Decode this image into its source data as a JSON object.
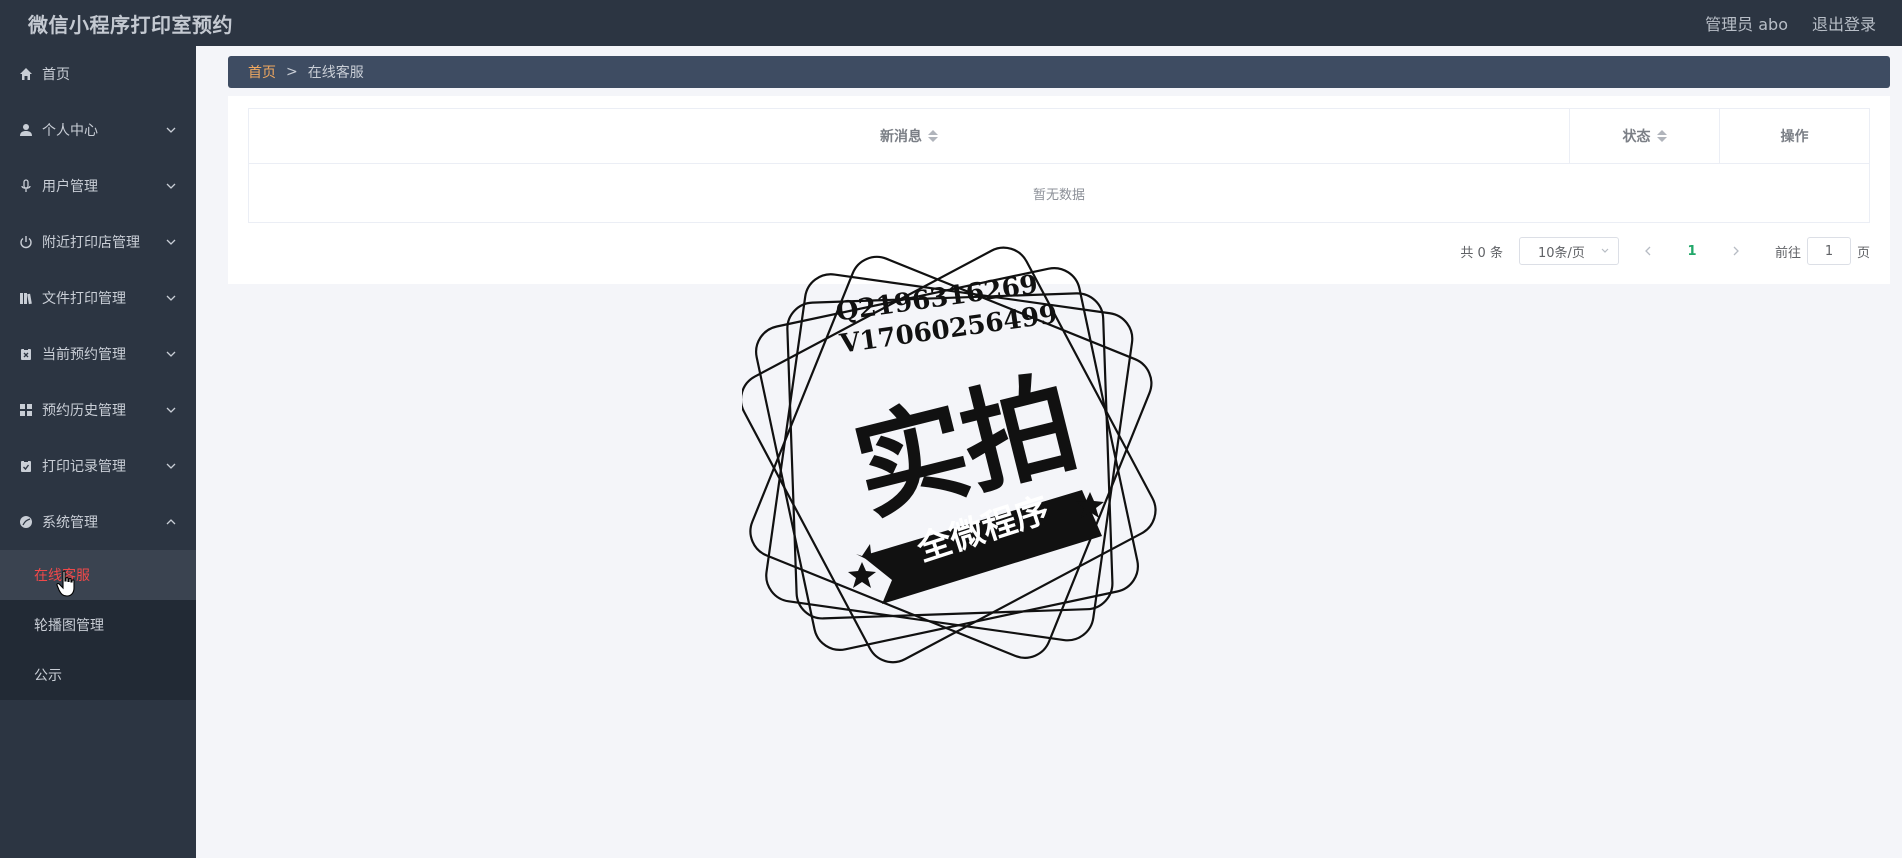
{
  "header": {
    "title": "微信小程序打印室预约",
    "user": "管理员 abo",
    "logout": "退出登录"
  },
  "sidebar": {
    "items": [
      {
        "label": "首页",
        "icon": "home-icon"
      },
      {
        "label": "个人中心",
        "icon": "user-icon"
      },
      {
        "label": "用户管理",
        "icon": "mic-icon"
      },
      {
        "label": "附近打印店管理",
        "icon": "power-icon"
      },
      {
        "label": "文件打印管理",
        "icon": "bookshelf-icon"
      },
      {
        "label": "当前预约管理",
        "icon": "clipboard-x-icon"
      },
      {
        "label": "预约历史管理",
        "icon": "grid-icon"
      },
      {
        "label": "打印记录管理",
        "icon": "clipboard-check-icon"
      },
      {
        "label": "系统管理",
        "icon": "leaf-icon"
      }
    ],
    "subitems": [
      {
        "label": "在线客服",
        "active": true
      },
      {
        "label": "轮播图管理"
      },
      {
        "label": "公示"
      }
    ]
  },
  "breadcrumb": {
    "home": "首页",
    "separator": ">",
    "current": "在线客服"
  },
  "table": {
    "columns": [
      "新消息",
      "状态",
      "操作"
    ],
    "empty_text": "暂无数据"
  },
  "pagination": {
    "total": "共 0 条",
    "page_size": "10条/页",
    "current_page": "1",
    "goto_label": "前往",
    "goto_value": "1",
    "page_suffix": "页"
  },
  "watermark": {
    "q": "Q2196316269",
    "v": "V17060256499",
    "big": "实拍",
    "ribbon": "全微程序"
  },
  "colors": {
    "sidebar_bg": "#2c3542",
    "breadcrumb_bg": "#3e4c62",
    "active_text": "#f0494a",
    "breadcrumb_home": "#f0a860",
    "page_active": "#22a86a"
  }
}
